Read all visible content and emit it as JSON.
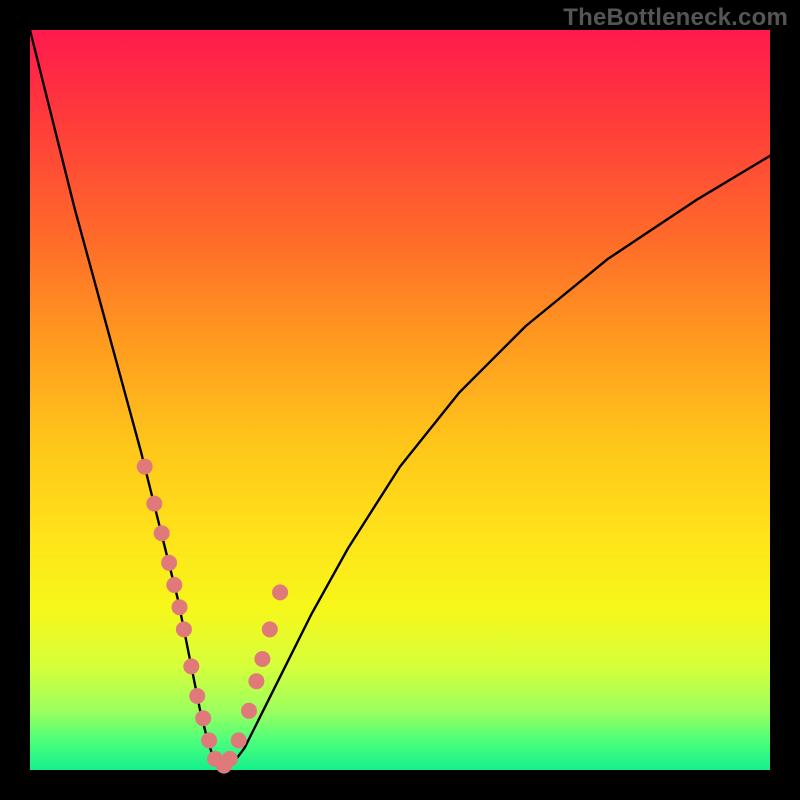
{
  "watermark": "TheBottleneck.com",
  "chart_data": {
    "type": "line",
    "title": "",
    "xlabel": "",
    "ylabel": "",
    "xlim": [
      0,
      100
    ],
    "ylim": [
      0,
      100
    ],
    "grid": false,
    "legend": false,
    "x": [
      0,
      3,
      6,
      9,
      12,
      15,
      17,
      18.5,
      20,
      21,
      22,
      23,
      24,
      25,
      26,
      27.5,
      29,
      31,
      34,
      38,
      43,
      50,
      58,
      67,
      78,
      90,
      100
    ],
    "values": [
      100,
      88,
      76,
      65,
      54,
      43,
      35,
      29,
      23,
      18,
      13,
      8,
      4,
      1,
      0.3,
      1,
      3,
      7,
      13,
      21,
      30,
      41,
      51,
      60,
      69,
      77,
      83
    ],
    "series": [
      {
        "name": "data-points",
        "style": "scatter",
        "x": [
          15.5,
          16.8,
          17.8,
          18.8,
          19.5,
          20.2,
          20.8,
          21.8,
          22.6,
          23.4,
          24.2,
          25.0,
          26.2,
          27.0,
          28.2,
          29.6,
          30.6,
          31.4,
          32.4,
          33.8
        ],
        "values": [
          41,
          36,
          32,
          28,
          25,
          22,
          19,
          14,
          10,
          7,
          4,
          1.5,
          0.6,
          1.5,
          4,
          8,
          12,
          15,
          19,
          24
        ]
      }
    ]
  }
}
